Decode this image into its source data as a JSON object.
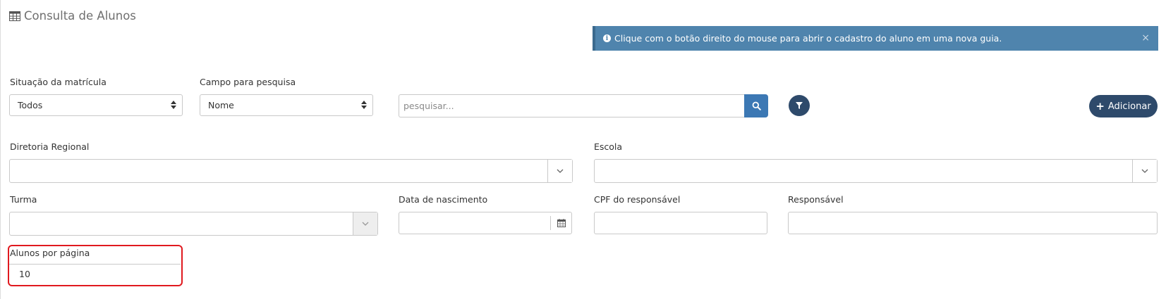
{
  "header": {
    "title": "Consulta de Alunos",
    "icon": "table-icon"
  },
  "alert": {
    "text": "Clique com o botão direito do mouse para abrir o cadastro do aluno em uma nova guia.",
    "close_label": "×",
    "color": "#4f84ad"
  },
  "filters": {
    "situacao": {
      "label": "Situação da matrícula",
      "value": "Todos"
    },
    "campo": {
      "label": "Campo para pesquisa",
      "value": "Nome"
    },
    "search": {
      "placeholder": "pesquisar..."
    },
    "diretoria": {
      "label": "Diretoria Regional",
      "value": ""
    },
    "escola": {
      "label": "Escola",
      "value": ""
    },
    "turma": {
      "label": "Turma",
      "value": ""
    },
    "nascimento": {
      "label": "Data de nascimento",
      "value": ""
    },
    "cpf": {
      "label": "CPF do responsável",
      "value": ""
    },
    "responsavel": {
      "label": "Responsável",
      "value": ""
    },
    "per_page": {
      "label": "Alunos por página",
      "value": "10"
    }
  },
  "actions": {
    "add_label": "Adicionar"
  },
  "colors": {
    "primary_dark": "#2e4a6b",
    "search_blue": "#3c78b4",
    "highlight_red": "#e0191f"
  }
}
